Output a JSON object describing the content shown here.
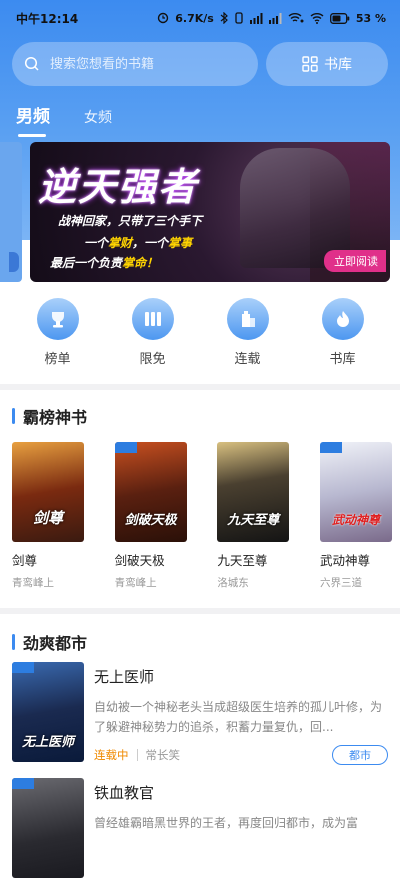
{
  "status_bar": {
    "time": "中午12:14",
    "speed": "6.7K/s",
    "battery": "53"
  },
  "search": {
    "placeholder": "搜索您想看的书籍"
  },
  "shelf_button": {
    "label": "书库"
  },
  "tabs": [
    {
      "label": "男频",
      "active": true
    },
    {
      "label": "女频",
      "active": false
    }
  ],
  "banner": {
    "title": "逆天强者",
    "line1": "战神回家，只带了三个手下",
    "line2_a": "一个",
    "line2_b": "掌财",
    "line2_c": "，一个",
    "line2_d": "掌事",
    "line3_a": "最后一个负责",
    "line3_b": "掌命！",
    "button": "立即阅读"
  },
  "quick_links": [
    {
      "label": "榜单",
      "icon": "trophy-icon"
    },
    {
      "label": "限免",
      "icon": "free-books-icon"
    },
    {
      "label": "连载",
      "icon": "serial-building-icon"
    },
    {
      "label": "书库",
      "icon": "flame-library-icon"
    }
  ],
  "section1": {
    "title": "霸榜神书",
    "books": [
      {
        "name": "剑尊",
        "author": "青鸾峰上",
        "cover_text": "剑尊",
        "colors": [
          "#e8a040",
          "#3a1a10"
        ]
      },
      {
        "name": "剑破天极",
        "author": "青鸾峰上",
        "cover_text": "剑破天极",
        "colors": [
          "#c85020",
          "#2a1008"
        ]
      },
      {
        "name": "九天至尊",
        "author": "洛城东",
        "cover_text": "九天至尊",
        "colors": [
          "#d8c080",
          "#141414"
        ]
      },
      {
        "name": "武动神尊",
        "author": "六界三道",
        "cover_text": "武动神尊",
        "colors": [
          "#d0d8e8",
          "#7a6a8a"
        ]
      }
    ]
  },
  "section2": {
    "title": "劲爽都市",
    "items": [
      {
        "title": "无上医师",
        "desc": "自幼被一个神秘老头当成超级医生培养的孤儿叶修，为了躲避神秘势力的追杀，积蓄力量复仇，回...",
        "status": "连载中",
        "author": "常长笑",
        "category": "都市",
        "cover_text": "无上医师",
        "colors": [
          "#3a6ab0",
          "#0a1a3a"
        ]
      },
      {
        "title": "铁血教官",
        "desc": "曾经雄霸暗黑世界的王者，再度回归都市，成为富",
        "cover_text": "",
        "colors": [
          "#6a6a70",
          "#1a1a20"
        ]
      }
    ]
  },
  "colors": {
    "accent": "#3c8bf0",
    "status_orange": "#f08a00"
  }
}
